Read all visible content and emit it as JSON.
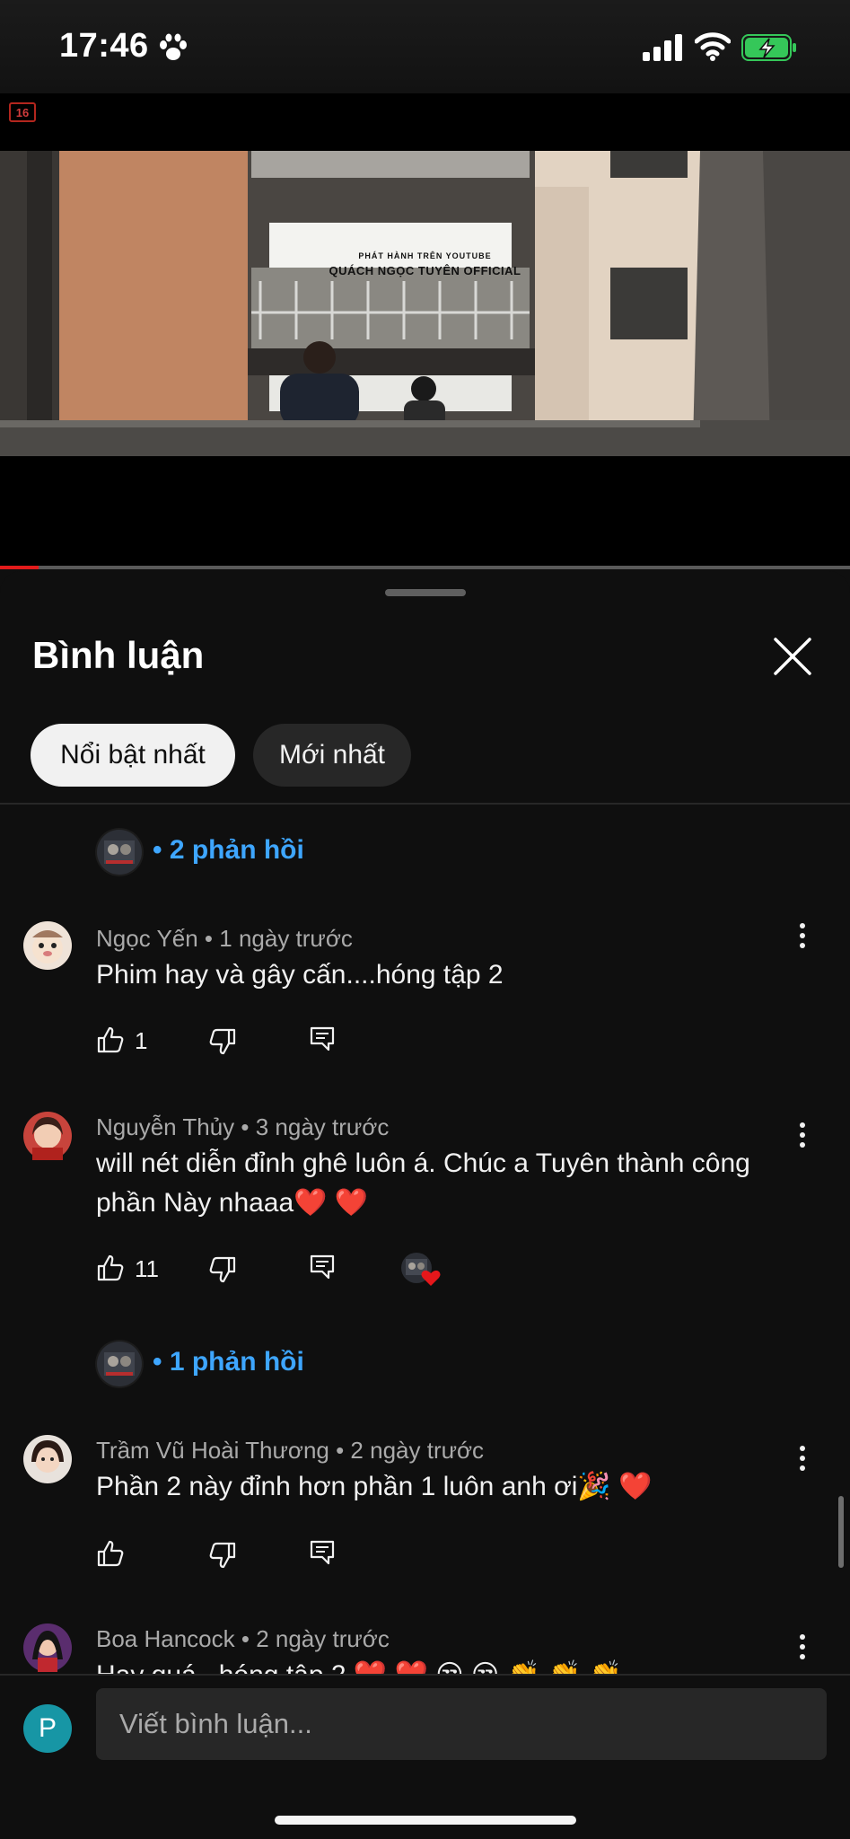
{
  "status_bar": {
    "time": "17:46"
  },
  "video": {
    "age_rating": "16",
    "watermark_line1": "PHÁT HÀNH TRÊN YOUTUBE",
    "watermark_line2": "QUÁCH NGỌC TUYÊN OFFICIAL",
    "progress_fraction": 0.045
  },
  "comments_panel": {
    "title": "Bình luận",
    "filters": [
      {
        "label": "Nổi bật nhất",
        "selected": true
      },
      {
        "label": "Mới nhất",
        "selected": false
      }
    ],
    "top_replies": {
      "label": "• 2 phản hồi"
    },
    "comments": [
      {
        "author_meta": "Ngọc Yến • 1 ngày trước",
        "text": "Phim hay và gây cấn....hóng tập 2",
        "likes": "1",
        "creator_heart": false
      },
      {
        "author_meta": "Nguyễn Thủy • 3 ngày trước",
        "text": "will nét diễn đỉnh ghê luôn á. Chúc a Tuyên thành công phần Này nhaaa❤️ ❤️",
        "likes": "11",
        "creator_heart": true,
        "replies_label": "• 1 phản hồi"
      },
      {
        "author_meta": "Trầm Vũ Hoài Thương • 2 ngày trước",
        "text": "Phần 2 này đỉnh hơn phần 1 luôn anh ơi🎉 ❤️",
        "likes": "",
        "creator_heart": false
      },
      {
        "author_meta": "Boa Hancock • 2 ngày trước",
        "text": "Hay quá , hóng tập 2 ❤️ ❤️ 😒 😒 👏 👏 👏",
        "likes": "",
        "creator_heart": false
      }
    ]
  },
  "compose": {
    "avatar_initial": "P",
    "placeholder": "Viết bình luận..."
  },
  "colors": {
    "background": "#0f0f0f",
    "chip_selected": "#f1f1f1",
    "chip_unselected": "#272727",
    "link_blue": "#3ea6ff",
    "progress_red": "#e21b1b",
    "battery_green": "#35c759"
  }
}
